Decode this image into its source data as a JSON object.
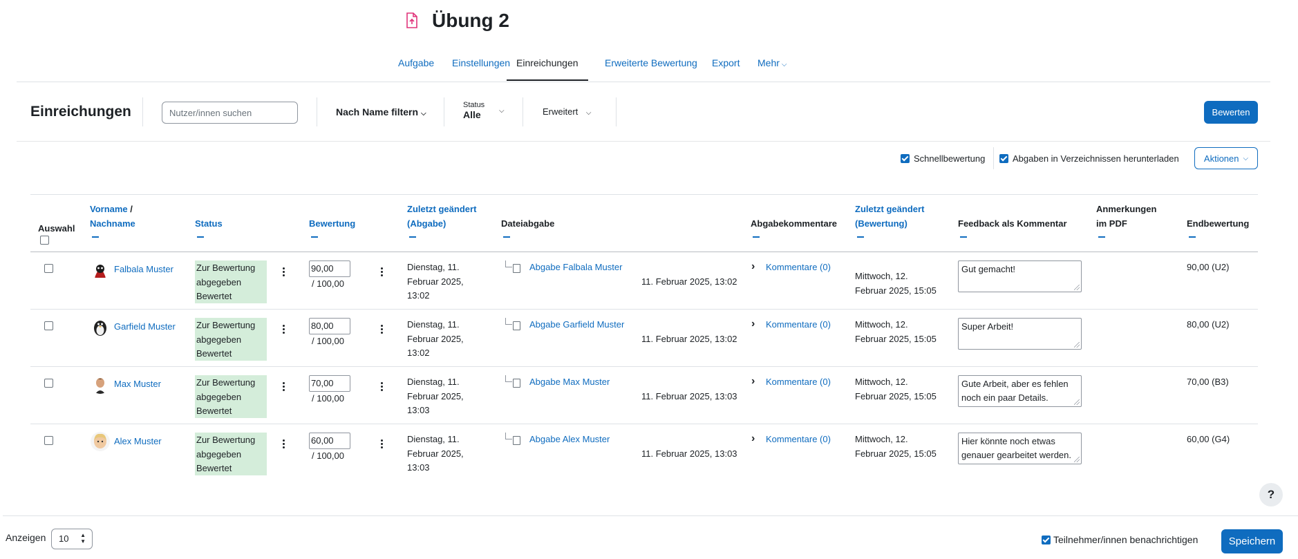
{
  "header": {
    "title": "Übung 2",
    "accent": "#e0337a"
  },
  "tabs": [
    {
      "label": "Aufgabe"
    },
    {
      "label": "Einstellungen"
    },
    {
      "label": "Einreichungen"
    },
    {
      "label": "Erweiterte Bewertung"
    },
    {
      "label": "Export"
    },
    {
      "label": "Mehr"
    }
  ],
  "filterbar": {
    "title": "Einreichungen",
    "search_placeholder": "Nutzer/innen suchen",
    "name_filter": "Nach Name filtern",
    "status_label": "Status",
    "status_value": "Alle",
    "advanced": "Erweitert",
    "grade_button": "Bewerten"
  },
  "options": {
    "quick_grading": "Schnellbewertung",
    "download_in_folders": "Abgaben in Verzeichnissen herunterladen",
    "actions": "Aktionen"
  },
  "table": {
    "headers": {
      "select": "Auswahl",
      "firstname": "Vorname",
      "slash": " /",
      "lastname": "Nachname",
      "status": "Status",
      "grade": "Bewertung",
      "modified_sub_1": "Zuletzt geändert",
      "modified_sub_2": "(Abgabe)",
      "file": "Dateiabgabe",
      "comments": "Abgabekommentare",
      "modified_grade_1": "Zuletzt geändert",
      "modified_grade_2": "(Bewertung)",
      "feedback": "Feedback als Kommentar",
      "pdf_1": "Anmerkungen",
      "pdf_2": "im PDF",
      "final": "Endbewertung"
    },
    "rows": [
      {
        "name": "Falbala Muster",
        "status_1": "Zur Bewertung",
        "status_2": "abgegeben",
        "status_3": "Bewertet",
        "grade": "90,00",
        "grade_max": "/ 100,00",
        "mod_1": "Dienstag, 11.",
        "mod_2": "Februar 2025,",
        "mod_3": "13:02",
        "file_link": "Abgabe Falbala Muster",
        "file_date": "11. Februar 2025, 13:02",
        "comments": "Kommentare (0)",
        "gmod_1": "Mittwoch, 12.",
        "gmod_2": "Februar 2025, 15:05",
        "feedback": "Gut gemacht!",
        "final": "90,00 (U2)"
      },
      {
        "name": "Garfield Muster",
        "status_1": "Zur Bewertung",
        "status_2": "abgegeben",
        "status_3": "Bewertet",
        "grade": "80,00",
        "grade_max": "/ 100,00",
        "mod_1": "Dienstag, 11.",
        "mod_2": "Februar 2025,",
        "mod_3": "13:02",
        "file_link": "Abgabe Garfield Muster",
        "file_date": "11. Februar 2025, 13:02",
        "comments": "Kommentare (0)",
        "gmod_1": "Mittwoch, 12.",
        "gmod_2": "Februar 2025, 15:05",
        "feedback": "Super Arbeit!",
        "final": "80,00 (U2)"
      },
      {
        "name": "Max Muster",
        "status_1": "Zur Bewertung",
        "status_2": "abgegeben",
        "status_3": "Bewertet",
        "grade": "70,00",
        "grade_max": "/ 100,00",
        "mod_1": "Dienstag, 11.",
        "mod_2": "Februar 2025,",
        "mod_3": "13:03",
        "file_link": "Abgabe Max Muster",
        "file_date": "11. Februar 2025, 13:03",
        "comments": "Kommentare (0)",
        "gmod_1": "Mittwoch, 12.",
        "gmod_2": "Februar 2025, 15:05",
        "feedback": "Gute Arbeit, aber es fehlen noch ein paar Details.",
        "final": "70,00 (B3)"
      },
      {
        "name": "Alex Muster",
        "status_1": "Zur Bewertung",
        "status_2": "abgegeben",
        "status_3": "Bewertet",
        "grade": "60,00",
        "grade_max": "/ 100,00",
        "mod_1": "Dienstag, 11.",
        "mod_2": "Februar 2025,",
        "mod_3": "13:03",
        "file_link": "Abgabe Alex Muster",
        "file_date": "11. Februar 2025, 13:03",
        "comments": "Kommentare (0)",
        "gmod_1": "Mittwoch, 12.",
        "gmod_2": "Februar 2025, 15:05",
        "feedback": "Hier könnte noch etwas genauer gearbeitet werden.",
        "final": "60,00 (G4)"
      }
    ]
  },
  "footer": {
    "show_label": "Anzeigen",
    "per_page": "10",
    "notify": "Teilnehmer/innen benachrichtigen",
    "save": "Speichern",
    "help": "?"
  }
}
